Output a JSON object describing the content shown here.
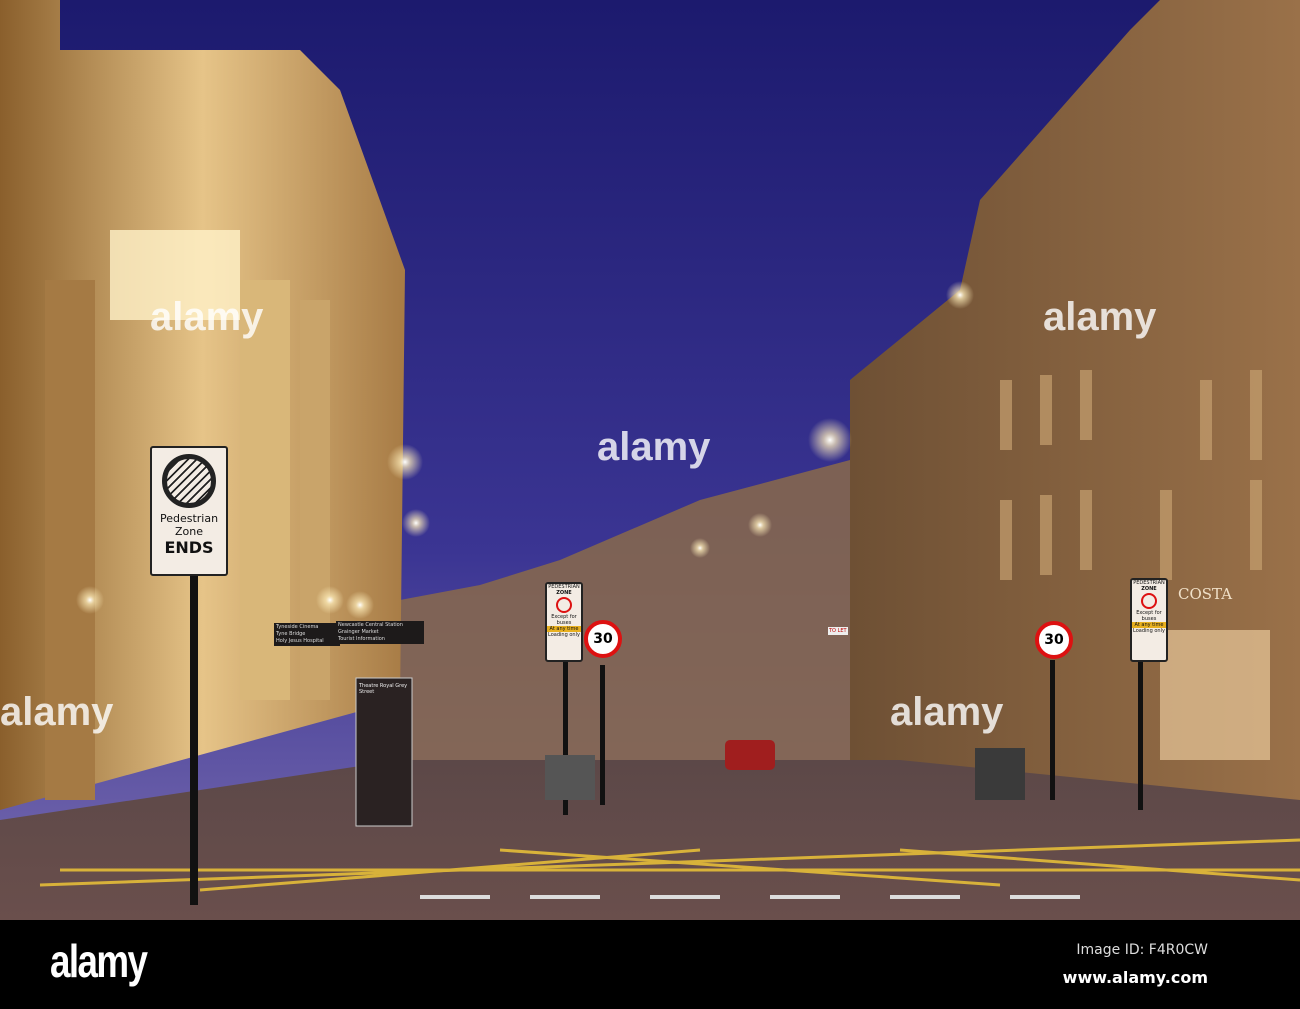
{
  "photo": {
    "description_alt": "Grey Street at dusk",
    "colors": {
      "sky_top": "#1c1a6e",
      "sky_bottom": "#5a4fa6",
      "stone": "#b98a4c",
      "road": "#5a4445"
    }
  },
  "signs": {
    "ends_sign": {
      "line1": "Pedestrian",
      "line2": "Zone",
      "line3": "ENDS"
    },
    "pedestrian_zone": {
      "title1": "PEDESTRIAN",
      "title2": "ZONE",
      "except": "Except for buses",
      "time": "At any time",
      "loading": "Loading only"
    },
    "speed_limit": "30",
    "direction_left": [
      "Tyneside Cinema",
      "Tyne Bridge",
      "Holy Jesus Hospital"
    ],
    "direction_right": [
      "Newcastle Central Station",
      "Grainger Market",
      "Tourist Information"
    ],
    "info_board": "Theatre Royal Grey Street",
    "shop": "COSTA",
    "to_let": "TO LET"
  },
  "watermark": {
    "text": "alamy"
  },
  "footer": {
    "logo": "alamy",
    "image_id": "Image ID: F4R0CW",
    "url": "www.alamy.com"
  }
}
